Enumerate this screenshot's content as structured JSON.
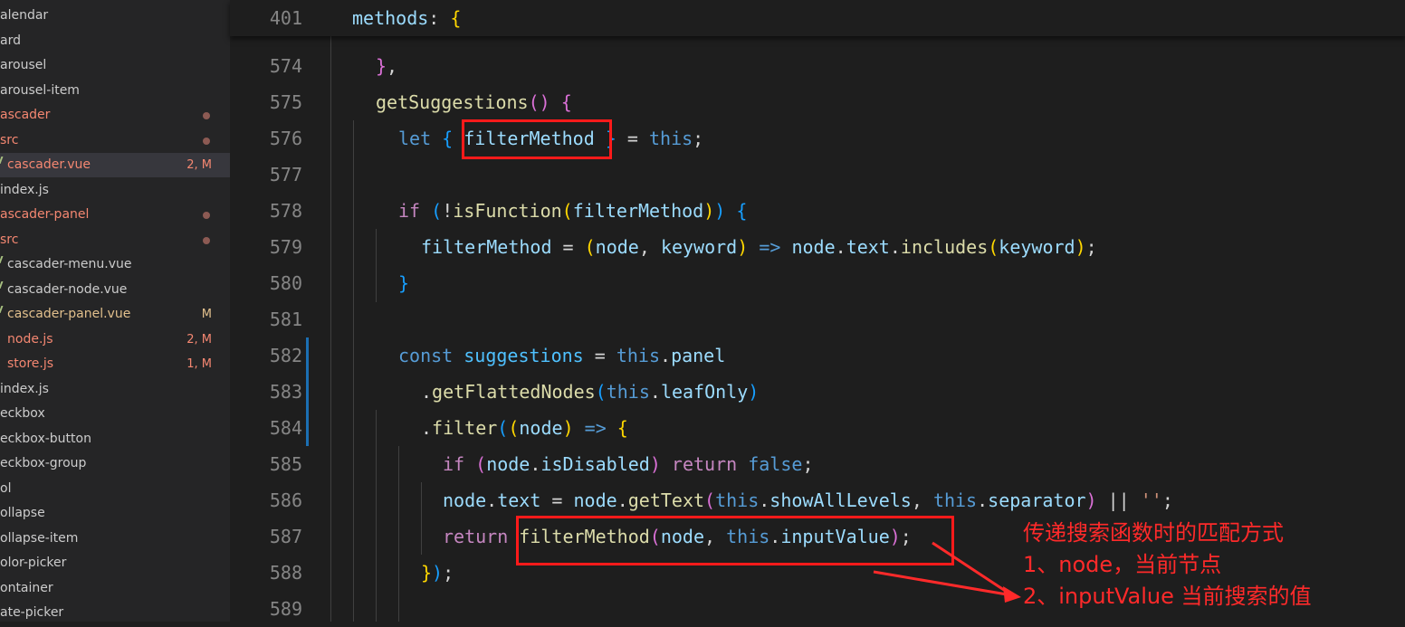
{
  "sidebar": {
    "items": [
      {
        "label": "alendar",
        "color": "#cccccc"
      },
      {
        "label": "ard",
        "color": "#cccccc"
      },
      {
        "label": "arousel",
        "color": "#cccccc"
      },
      {
        "label": "arousel-item",
        "color": "#cccccc"
      },
      {
        "label": "ascader",
        "color": "#f48771",
        "dot": true
      },
      {
        "label": "src",
        "color": "#f48771",
        "dot": true
      },
      {
        "label": "cascader.vue",
        "color": "#f48771",
        "badge": "2, M",
        "active": true,
        "file": true
      },
      {
        "label": "index.js",
        "color": "#cccccc"
      },
      {
        "label": "ascader-panel",
        "color": "#f48771",
        "dot": true
      },
      {
        "label": "src",
        "color": "#f48771",
        "dot": true
      },
      {
        "label": "cascader-menu.vue",
        "color": "#cccccc",
        "file": true
      },
      {
        "label": "cascader-node.vue",
        "color": "#cccccc",
        "file": true
      },
      {
        "label": "cascader-panel.vue",
        "color": "#e2c08d",
        "badge": "M",
        "file": true
      },
      {
        "label": "node.js",
        "color": "#f48771",
        "badge": "2, M"
      },
      {
        "label": "store.js",
        "color": "#f48771",
        "badge": "1, M"
      },
      {
        "label": "index.js",
        "color": "#cccccc"
      },
      {
        "label": "eckbox",
        "color": "#cccccc"
      },
      {
        "label": "eckbox-button",
        "color": "#cccccc"
      },
      {
        "label": "eckbox-group",
        "color": "#cccccc"
      },
      {
        "label": "ol",
        "color": "#cccccc"
      },
      {
        "label": "ollapse",
        "color": "#cccccc"
      },
      {
        "label": "ollapse-item",
        "color": "#cccccc"
      },
      {
        "label": "olor-picker",
        "color": "#cccccc"
      },
      {
        "label": "ontainer",
        "color": "#cccccc"
      },
      {
        "label": "ate-picker",
        "color": "#cccccc"
      }
    ]
  },
  "editor": {
    "sticky": {
      "line": "401",
      "code": [
        [
          "v",
          "methods"
        ],
        [
          "p",
          ": "
        ],
        [
          "b1",
          "{"
        ]
      ]
    },
    "lines": [
      {
        "n": "574",
        "indent": 1,
        "code": [
          [
            "b2",
            "}"
          ],
          [
            "p",
            ","
          ]
        ]
      },
      {
        "n": "575",
        "indent": 1,
        "code": [
          [
            "f",
            "getSuggestions"
          ],
          [
            "b2",
            "()"
          ],
          [
            "p",
            " "
          ],
          [
            "b2",
            "{"
          ]
        ]
      },
      {
        "n": "576",
        "indent": 2,
        "code": [
          [
            "s",
            "let"
          ],
          [
            "p",
            " "
          ],
          [
            "b3",
            "{"
          ],
          [
            "p",
            " "
          ],
          [
            "v",
            "filterMethod"
          ],
          [
            "p",
            " "
          ],
          [
            "b3",
            "}"
          ],
          [
            "p",
            " = "
          ],
          [
            "s",
            "this"
          ],
          [
            "p",
            ";"
          ]
        ]
      },
      {
        "n": "577",
        "indent": 2,
        "code": []
      },
      {
        "n": "578",
        "indent": 2,
        "code": [
          [
            "k",
            "if"
          ],
          [
            "p",
            " "
          ],
          [
            "b3",
            "("
          ],
          [
            "p",
            "!"
          ],
          [
            "f",
            "isFunction"
          ],
          [
            "b1",
            "("
          ],
          [
            "v",
            "filterMethod"
          ],
          [
            "b1",
            ")"
          ],
          [
            "b3",
            ")"
          ],
          [
            "p",
            " "
          ],
          [
            "b3",
            "{"
          ]
        ]
      },
      {
        "n": "579",
        "indent": 3,
        "code": [
          [
            "v",
            "filterMethod"
          ],
          [
            "p",
            " = "
          ],
          [
            "b1",
            "("
          ],
          [
            "v",
            "node"
          ],
          [
            "p",
            ", "
          ],
          [
            "v",
            "keyword"
          ],
          [
            "b1",
            ")"
          ],
          [
            "p",
            " "
          ],
          [
            "s",
            "=>"
          ],
          [
            "p",
            " "
          ],
          [
            "v",
            "node"
          ],
          [
            "p",
            "."
          ],
          [
            "v",
            "text"
          ],
          [
            "p",
            "."
          ],
          [
            "f",
            "includes"
          ],
          [
            "b1",
            "("
          ],
          [
            "v",
            "keyword"
          ],
          [
            "b1",
            ")"
          ],
          [
            "p",
            ";"
          ]
        ]
      },
      {
        "n": "580",
        "indent": 2,
        "code": [
          [
            "b3",
            "}"
          ]
        ]
      },
      {
        "n": "581",
        "indent": 2,
        "code": []
      },
      {
        "n": "582",
        "indent": 2,
        "code": [
          [
            "s",
            "const"
          ],
          [
            "p",
            " "
          ],
          [
            "c",
            "suggestions"
          ],
          [
            "p",
            " = "
          ],
          [
            "s",
            "this"
          ],
          [
            "p",
            "."
          ],
          [
            "v",
            "panel"
          ]
        ]
      },
      {
        "n": "583",
        "indent": 3,
        "code": [
          [
            "p",
            "."
          ],
          [
            "f",
            "getFlattedNodes"
          ],
          [
            "b3",
            "("
          ],
          [
            "s",
            "this"
          ],
          [
            "p",
            "."
          ],
          [
            "v",
            "leafOnly"
          ],
          [
            "b3",
            ")"
          ]
        ]
      },
      {
        "n": "584",
        "indent": 3,
        "code": [
          [
            "p",
            "."
          ],
          [
            "f",
            "filter"
          ],
          [
            "b3",
            "("
          ],
          [
            "b1",
            "("
          ],
          [
            "v",
            "node"
          ],
          [
            "b1",
            ")"
          ],
          [
            "p",
            " "
          ],
          [
            "s",
            "=>"
          ],
          [
            "p",
            " "
          ],
          [
            "b1",
            "{"
          ]
        ]
      },
      {
        "n": "585",
        "indent": 4,
        "code": [
          [
            "k",
            "if"
          ],
          [
            "p",
            " "
          ],
          [
            "b2",
            "("
          ],
          [
            "v",
            "node"
          ],
          [
            "p",
            "."
          ],
          [
            "v",
            "isDisabled"
          ],
          [
            "b2",
            ")"
          ],
          [
            "p",
            " "
          ],
          [
            "k",
            "return"
          ],
          [
            "p",
            " "
          ],
          [
            "s",
            "false"
          ],
          [
            "p",
            ";"
          ]
        ]
      },
      {
        "n": "586",
        "indent": 4,
        "code": [
          [
            "v",
            "node"
          ],
          [
            "p",
            "."
          ],
          [
            "v",
            "text"
          ],
          [
            "p",
            " = "
          ],
          [
            "v",
            "node"
          ],
          [
            "p",
            "."
          ],
          [
            "f",
            "getText"
          ],
          [
            "b2",
            "("
          ],
          [
            "s",
            "this"
          ],
          [
            "p",
            "."
          ],
          [
            "v",
            "showAllLevels"
          ],
          [
            "p",
            ", "
          ],
          [
            "s",
            "this"
          ],
          [
            "p",
            "."
          ],
          [
            "v",
            "separator"
          ],
          [
            "b2",
            ")"
          ],
          [
            "p",
            " || "
          ],
          [
            "str",
            "''"
          ],
          [
            "p",
            ";"
          ]
        ]
      },
      {
        "n": "587",
        "indent": 4,
        "code": [
          [
            "k",
            "return"
          ],
          [
            "p",
            " "
          ],
          [
            "f",
            "filterMethod"
          ],
          [
            "b2",
            "("
          ],
          [
            "v",
            "node"
          ],
          [
            "p",
            ", "
          ],
          [
            "s",
            "this"
          ],
          [
            "p",
            "."
          ],
          [
            "v",
            "inputValue"
          ],
          [
            "b2",
            ")"
          ],
          [
            "p",
            ";"
          ]
        ]
      },
      {
        "n": "588",
        "indent": 3,
        "code": [
          [
            "b1",
            "}"
          ],
          [
            "b3",
            ")"
          ],
          [
            "p",
            ";"
          ]
        ]
      },
      {
        "n": "589",
        "indent": 2,
        "code": []
      }
    ]
  },
  "annotation": {
    "line1": "传递搜索函数时的匹配方式",
    "line2": "1、node，当前节点",
    "line3": "2、inputValue 当前搜索的值"
  }
}
